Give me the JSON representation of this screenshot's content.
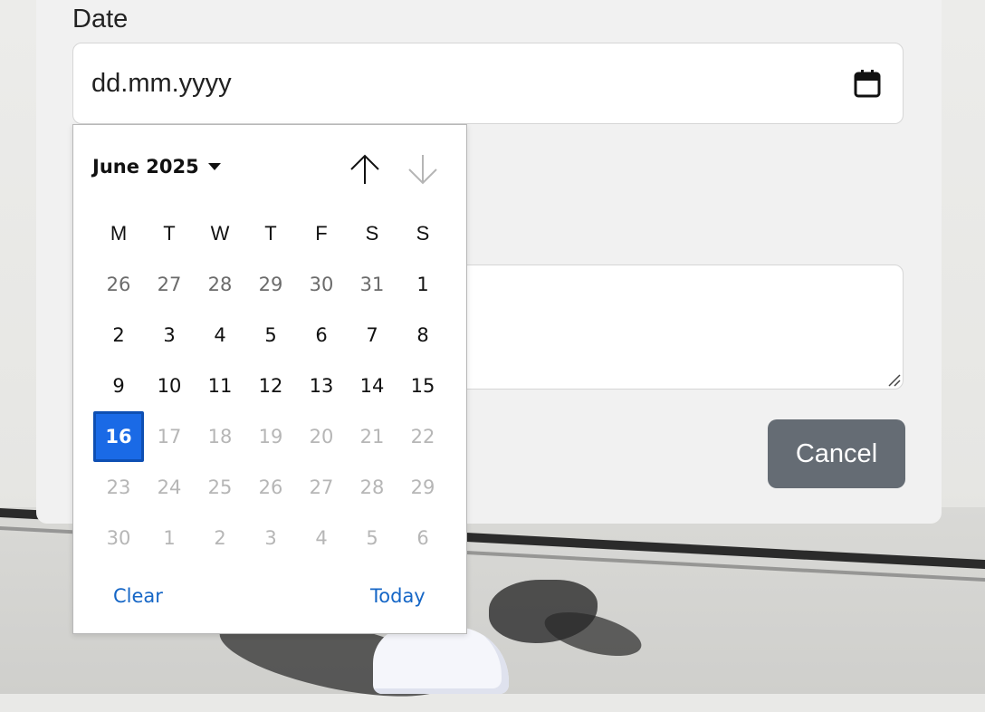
{
  "form": {
    "date_label": "Date",
    "date_placeholder": "dd.mm.yyyy",
    "cancel_label": "Cancel"
  },
  "datepicker": {
    "month_year": "June 2025",
    "weekdays": [
      "M",
      "T",
      "W",
      "T",
      "F",
      "S",
      "S"
    ],
    "weeks": [
      [
        {
          "d": "26",
          "s": "other"
        },
        {
          "d": "27",
          "s": "other"
        },
        {
          "d": "28",
          "s": "other"
        },
        {
          "d": "29",
          "s": "other"
        },
        {
          "d": "30",
          "s": "other"
        },
        {
          "d": "31",
          "s": "other"
        },
        {
          "d": "1",
          "s": "cur"
        }
      ],
      [
        {
          "d": "2",
          "s": "cur"
        },
        {
          "d": "3",
          "s": "cur"
        },
        {
          "d": "4",
          "s": "cur"
        },
        {
          "d": "5",
          "s": "cur"
        },
        {
          "d": "6",
          "s": "cur"
        },
        {
          "d": "7",
          "s": "cur"
        },
        {
          "d": "8",
          "s": "cur"
        }
      ],
      [
        {
          "d": "9",
          "s": "cur"
        },
        {
          "d": "10",
          "s": "cur"
        },
        {
          "d": "11",
          "s": "cur"
        },
        {
          "d": "12",
          "s": "cur"
        },
        {
          "d": "13",
          "s": "cur"
        },
        {
          "d": "14",
          "s": "cur"
        },
        {
          "d": "15",
          "s": "cur"
        }
      ],
      [
        {
          "d": "16",
          "s": "sel"
        },
        {
          "d": "17",
          "s": "dis"
        },
        {
          "d": "18",
          "s": "dis"
        },
        {
          "d": "19",
          "s": "dis"
        },
        {
          "d": "20",
          "s": "dis"
        },
        {
          "d": "21",
          "s": "dis"
        },
        {
          "d": "22",
          "s": "dis"
        }
      ],
      [
        {
          "d": "23",
          "s": "dis"
        },
        {
          "d": "24",
          "s": "dis"
        },
        {
          "d": "25",
          "s": "dis"
        },
        {
          "d": "26",
          "s": "dis"
        },
        {
          "d": "27",
          "s": "dis"
        },
        {
          "d": "28",
          "s": "dis"
        },
        {
          "d": "29",
          "s": "dis"
        }
      ],
      [
        {
          "d": "30",
          "s": "dis"
        },
        {
          "d": "1",
          "s": "dis"
        },
        {
          "d": "2",
          "s": "dis"
        },
        {
          "d": "3",
          "s": "dis"
        },
        {
          "d": "4",
          "s": "dis"
        },
        {
          "d": "5",
          "s": "dis"
        },
        {
          "d": "6",
          "s": "dis"
        }
      ]
    ],
    "clear_label": "Clear",
    "today_label": "Today",
    "icons": {
      "prev": "arrow-up-icon",
      "next": "arrow-down-icon",
      "calendar": "calendar-icon",
      "caret": "caret-down-icon"
    }
  },
  "colors": {
    "selected": "#1a6ae6",
    "link": "#1566c6",
    "cancel_bg": "#656c74"
  }
}
